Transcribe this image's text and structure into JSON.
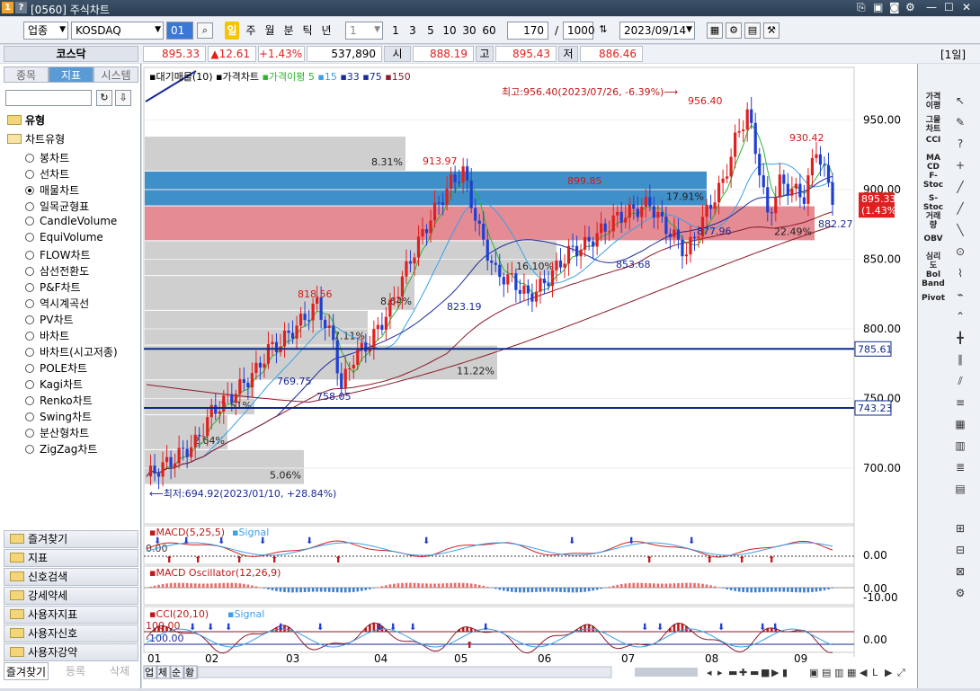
{
  "window": {
    "title": "[0560] 주식차트",
    "badge_left": "1",
    "badge_help": "?"
  },
  "toolbar": {
    "market_type": "업종",
    "market_name": "KOSDAQ",
    "code": "01",
    "period_buttons": [
      "일",
      "주",
      "월",
      "분",
      "틱",
      "년"
    ],
    "active_period": "일",
    "interval_select": "1",
    "interval_buttons": [
      "1",
      "3",
      "5",
      "10",
      "30",
      "60"
    ],
    "count_value": "170",
    "total_value": "1000",
    "date_value": "2023/09/14"
  },
  "pricebar": {
    "name": "코스닥",
    "current": "895.33",
    "change": "▲12.61",
    "change_pct": "+1.43%",
    "volume": "537,890",
    "open_label": "시",
    "open": "888.19",
    "high_label": "고",
    "high": "895.43",
    "low_label": "저",
    "low": "886.46",
    "period_tag": "[1일]"
  },
  "left_panel": {
    "tabs": [
      "종목",
      "지표",
      "시스템"
    ],
    "active_tab": "지표",
    "root_label": "유형",
    "group_label": "차트유형",
    "chart_types": [
      "봉차트",
      "선차트",
      "매물차트",
      "일목균형표",
      "CandleVolume",
      "EquiVolume",
      "FLOW차트",
      "삼선전환도",
      "P&F차트",
      "역시계곡선",
      "PV차트",
      "바차트",
      "바차트(시고저종)",
      "POLE차트",
      "Kagi차트",
      "Renko차트",
      "Swing차트",
      "분산형차트",
      "ZigZag차트"
    ],
    "selected_type": "매물차트",
    "accordion": [
      "즐겨찾기",
      "지표",
      "신호검색",
      "강세약세",
      "사용자지표",
      "사용자신호",
      "사용자강약"
    ],
    "bottom_tabs": [
      "즐겨찾기",
      "등록",
      "삭제"
    ]
  },
  "main_chart": {
    "legend": [
      "대기매물(10)",
      "가격차트",
      "가격이평",
      "5",
      "15",
      "33",
      "75",
      "150"
    ],
    "y_ticks": [
      "950.00",
      "900.00",
      "850.00",
      "800.00",
      "750.00",
      "700.00"
    ],
    "current_price_tag": "895.33",
    "current_pct_tag": "(1.43%)",
    "hline_1": "785.61",
    "hline_2": "743.23",
    "high_note": "최고:956.40(2023/07/26, -6.39%)⟶",
    "low_note": "⟵최저:694.92(2023/01/10, +28.84%)",
    "peak_labels": [
      "956.40",
      "930.42",
      "913.97",
      "899.85",
      "818.56"
    ],
    "trough_labels": [
      "882.27",
      "877.96",
      "853.68",
      "823.19",
      "769.75",
      "758.05"
    ],
    "volume_profile_pcts": [
      "8.31%",
      "17.91%",
      "22.49%",
      "16.10%",
      "8.64%",
      "7.11%",
      "11.22%",
      "3.51%",
      "2.64%",
      "5.06%"
    ]
  },
  "macd": {
    "legend": "MACD(5,25,5)",
    "signal_legend": "Signal",
    "y_tick": "0.00",
    "left_value": "0.00"
  },
  "macd_osc": {
    "legend": "MACD Oscillator(12,26,9)",
    "y_ticks": [
      "0.00",
      "-10.00"
    ]
  },
  "cci": {
    "legend": "CCI(20,10)",
    "signal_legend": "Signal",
    "y_tick": "0.00",
    "left_values": [
      "100.00",
      "-100.00"
    ]
  },
  "x_axis": [
    "01",
    "02",
    "03",
    "04",
    "05",
    "06",
    "07",
    "08",
    "09"
  ],
  "bottom_tools": [
    "업",
    "체",
    "순",
    "황"
  ],
  "right_indicators": [
    "가격 이평",
    "그물 차트",
    "CCI",
    "MA CD",
    "F-Stoc",
    "S-Stoc",
    "거래 량",
    "OBV",
    "심리 도",
    "Bol Band",
    "Pivot"
  ],
  "colors": {
    "up": "#e02020",
    "down": "#1f3fd0",
    "ma5": "#2db52d",
    "ma15": "#3aa0e8",
    "ma33": "#1b2a9a",
    "ma75": "#8b1a2a",
    "hline": "#0d2a8a",
    "band_blue": "#3f8fc8",
    "band_red": "#e48b94"
  }
}
